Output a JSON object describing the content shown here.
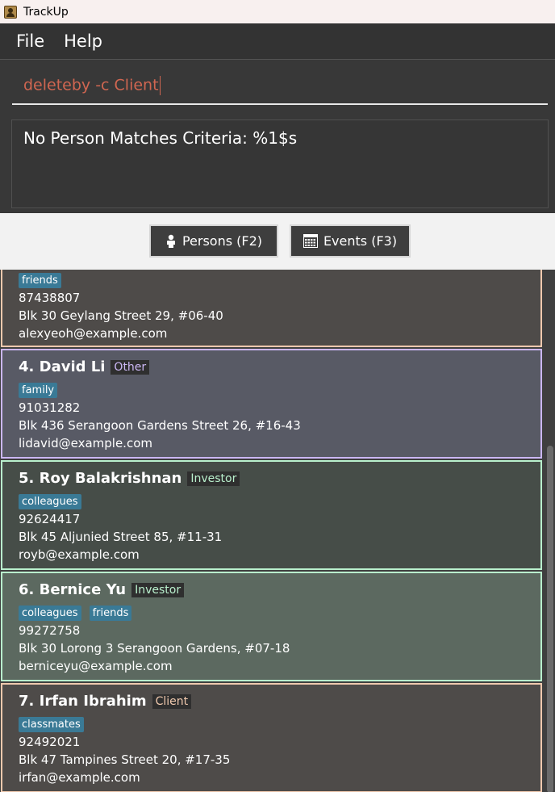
{
  "window": {
    "title": "TrackUp",
    "icon": "app-icon"
  },
  "menu": {
    "file": "File",
    "help": "Help"
  },
  "command": {
    "value": "deleteby -c Client"
  },
  "result": {
    "message": "No Person Matches Criteria: %1$s"
  },
  "tabs": {
    "persons": {
      "label": "Persons (F2)",
      "icon": "person-icon"
    },
    "events": {
      "label": "Events (F3)",
      "icon": "calendar-icon"
    }
  },
  "colors": {
    "command_text": "#d06651",
    "tag_bg": "#3a7a96",
    "client_border": "#f0c9ae",
    "other_border": "#cbb7f4",
    "investor_border": "#b9f0cd",
    "other_role_text": "#cbb7f4",
    "investor_role_text": "#b9f0cd",
    "client_role_text": "#f0c9ae"
  },
  "persons": [
    {
      "tags": [
        "friends"
      ],
      "phone": "87438807",
      "address": "Blk 30 Geylang Street 29, #06-40",
      "email": "alexyeoh@example.com"
    },
    {
      "name": "4.  David Li",
      "role": "Other",
      "tags": [
        "family"
      ],
      "phone": "91031282",
      "address": "Blk 436 Serangoon Gardens Street 26, #16-43",
      "email": "lidavid@example.com"
    },
    {
      "name": "5.  Roy Balakrishnan",
      "role": "Investor",
      "tags": [
        "colleagues"
      ],
      "phone": "92624417",
      "address": "Blk 45 Aljunied Street 85, #11-31",
      "email": "royb@example.com"
    },
    {
      "name": "6.  Bernice Yu",
      "role": "Investor",
      "tags": [
        "colleagues",
        "friends"
      ],
      "phone": "99272758",
      "address": "Blk 30 Lorong 3 Serangoon Gardens, #07-18",
      "email": "berniceyu@example.com"
    },
    {
      "name": "7.  Irfan Ibrahim",
      "role": "Client",
      "tags": [
        "classmates"
      ],
      "phone": "92492021",
      "address": "Blk 47 Tampines Street 20, #17-35",
      "email": "irfan@example.com"
    }
  ]
}
